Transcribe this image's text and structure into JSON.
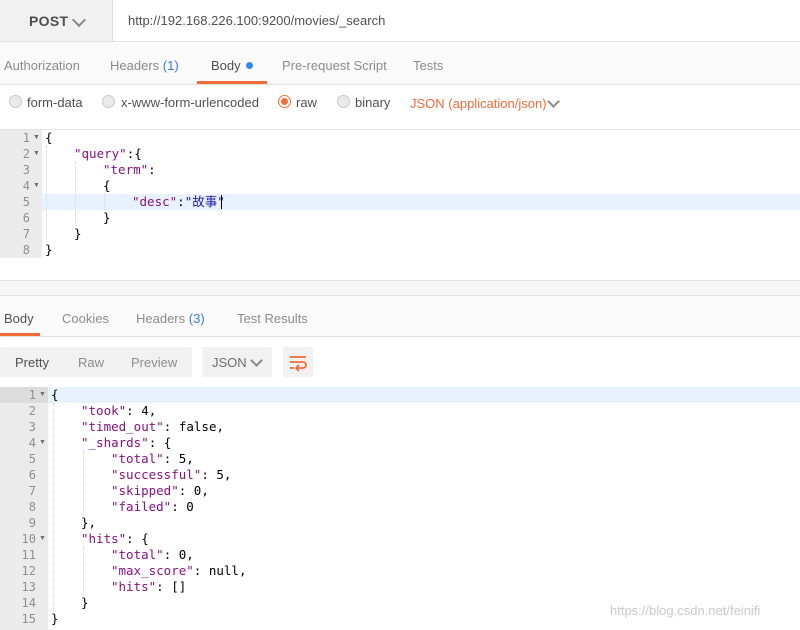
{
  "request": {
    "method": "POST",
    "url": "http://192.168.226.100:9200/movies/_search"
  },
  "request_tabs": {
    "authorization": "Authorization",
    "headers": "Headers",
    "headers_count": "(1)",
    "body": "Body",
    "prerequest": "Pre-request Script",
    "tests": "Tests"
  },
  "body_types": {
    "form_data": "form-data",
    "urlencoded": "x-www-form-urlencoded",
    "raw": "raw",
    "binary": "binary",
    "selected": "raw",
    "content_type": "JSON (application/json)"
  },
  "request_body": {
    "line_numbers": [
      "1",
      "2",
      "3",
      "4",
      "5",
      "6",
      "7",
      "8"
    ],
    "l1": "{",
    "l2_key": "\"query\"",
    "l2_rest": ":{",
    "l3_key": "\"term\"",
    "l3_rest": ":",
    "l4": "{",
    "l5_key": "\"desc\"",
    "l5_colon": ":",
    "l5_val": "\"故事\"",
    "l6": "}",
    "l7": "}",
    "l8": "}"
  },
  "response_tabs": {
    "body": "Body",
    "cookies": "Cookies",
    "headers": "Headers",
    "headers_count": "(3)",
    "test_results": "Test Results"
  },
  "response_toolbar": {
    "pretty": "Pretty",
    "raw": "Raw",
    "preview": "Preview",
    "language": "JSON",
    "wrap_icon": "wrap-lines-icon"
  },
  "response_body": {
    "line_numbers": [
      "1",
      "2",
      "3",
      "4",
      "5",
      "6",
      "7",
      "8",
      "9",
      "10",
      "11",
      "12",
      "13",
      "14",
      "15"
    ],
    "l1": "{",
    "took_key": "\"took\"",
    "took_val": "4",
    "timed_out_key": "\"timed_out\"",
    "timed_out_val": "false",
    "shards_key": "\"_shards\"",
    "total_key": "\"total\"",
    "total_val": "5",
    "successful_key": "\"successful\"",
    "successful_val": "5",
    "skipped_key": "\"skipped\"",
    "skipped_val": "0",
    "failed_key": "\"failed\"",
    "failed_val": "0",
    "shards_close": "},",
    "hits_key": "\"hits\"",
    "hits_total_key": "\"total\"",
    "hits_total_val": "0",
    "max_score_key": "\"max_score\"",
    "max_score_val": "null",
    "hits_arr_key": "\"hits\"",
    "hits_arr_val": "[]",
    "hits_close": "}",
    "l15": "}"
  },
  "watermark": "https://blog.csdn.net/feinifi",
  "colors": {
    "accent": "#f26b3a",
    "key": "#881280",
    "string": "#1a1aa6",
    "link_count": "#3a7bd5"
  }
}
